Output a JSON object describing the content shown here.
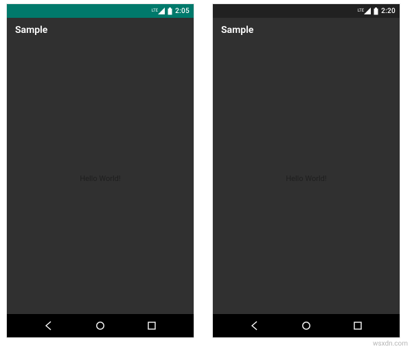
{
  "screens": [
    {
      "status_bar": {
        "color": "teal",
        "network": "LTE",
        "time": "2:05"
      },
      "app_title": "Sample",
      "body_text": "Hello World!"
    },
    {
      "status_bar": {
        "color": "dark",
        "network": "LTE",
        "time": "2:20"
      },
      "app_title": "Sample",
      "body_text": "Hello World!"
    }
  ],
  "watermark": "wsxdn.com"
}
